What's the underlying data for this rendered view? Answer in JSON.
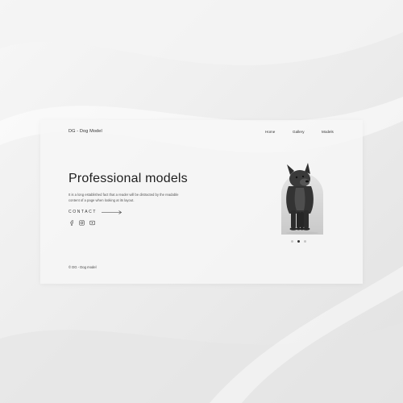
{
  "brand": {
    "logo": "DG - Dog Model"
  },
  "nav": {
    "items": [
      "Home",
      "Gallery",
      "Models"
    ]
  },
  "hero": {
    "title": "Professional models",
    "text": "It is a long established fact that a reader will be distracted by the readable content of a page when looking at its layout.",
    "contact_label": "CONTACT"
  },
  "socials": [
    "facebook-icon",
    "instagram-icon",
    "youtube-icon"
  ],
  "carousel": {
    "slides": 3,
    "active": 2
  },
  "footer": {
    "copyright": "© DG - Dog model"
  },
  "colors": {
    "background": "#ececec",
    "card": "#f6f6f6",
    "text": "#222222",
    "arch": "#d6d6d6"
  }
}
